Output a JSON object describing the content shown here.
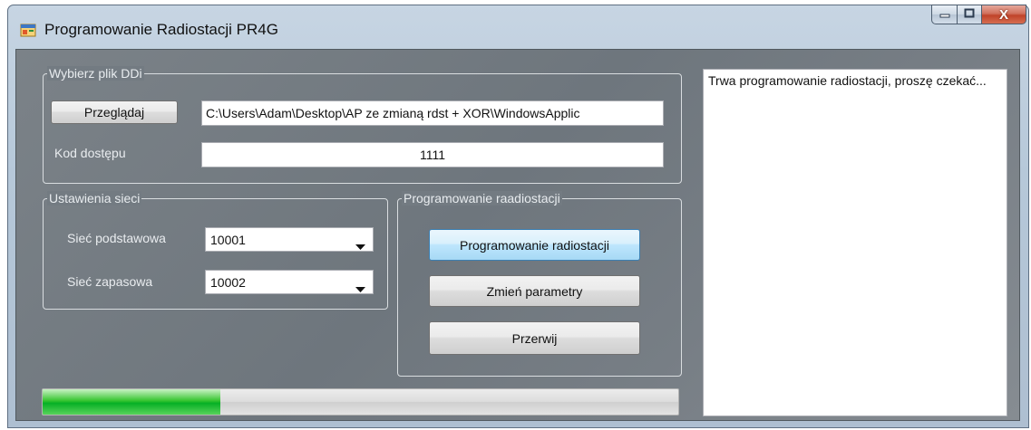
{
  "window": {
    "title": "Programowanie Radiostacji PR4G",
    "icon": "app-window-icon",
    "minimize_icon": "minimize-icon",
    "maximize_icon": "maximize-icon",
    "close_icon": "close-icon",
    "close_glyph": "X"
  },
  "file_group": {
    "legend": "Wybierz plik DDi",
    "browse_label": "Przeglądaj",
    "file_path": "C:\\Users\\Adam\\Desktop\\AP ze zmianą rdst + XOR\\WindowsApplic",
    "access_code_label": "Kod dostępu",
    "access_code_value": "1111"
  },
  "network_group": {
    "legend": "Ustawienia sieci",
    "primary_label": "Sieć podstawowa",
    "primary_value": "10001",
    "backup_label": "Sieć zapasowa",
    "backup_value": "10002"
  },
  "programming_group": {
    "legend": "Programowanie raadiostacji",
    "program_button": "Programowanie radiostacji",
    "change_params_button": "Zmień parametry",
    "abort_button": "Przerwij"
  },
  "progress": {
    "fraction": 0.28,
    "color": "#06b025"
  },
  "log": {
    "text": "Trwa programowanie radiostacji, proszę czekać..."
  }
}
